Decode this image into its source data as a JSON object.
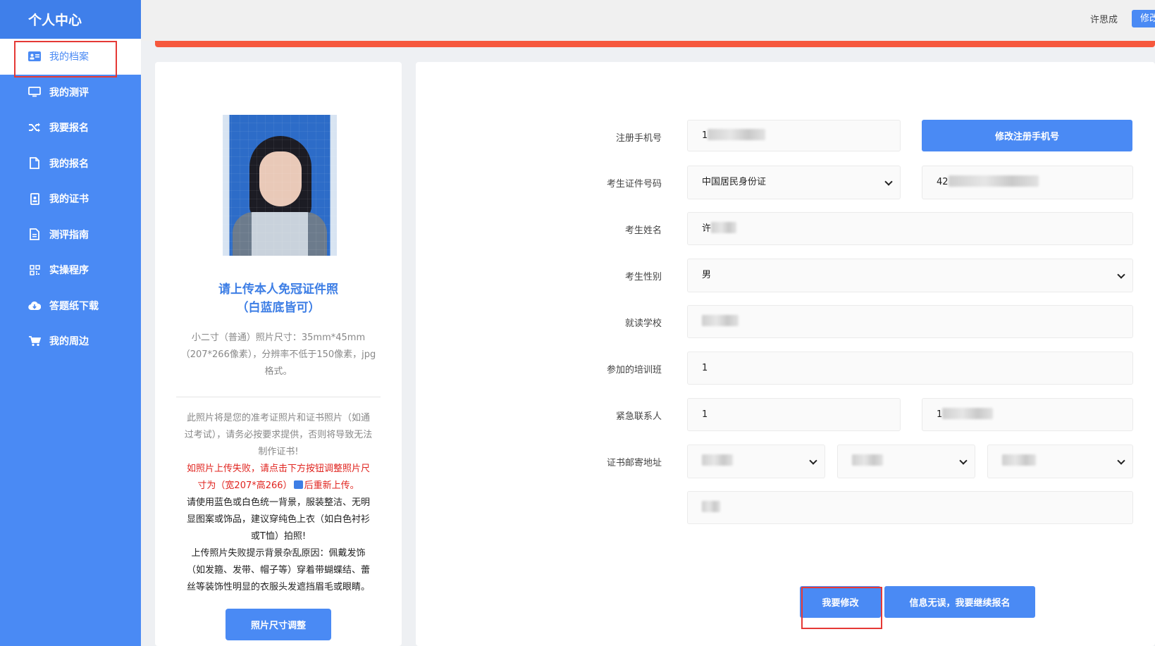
{
  "sidebar": {
    "title": "个人中心",
    "items": [
      {
        "label": "我的档案",
        "icon": "id-card-icon",
        "active": true
      },
      {
        "label": "我的测评",
        "icon": "monitor-icon"
      },
      {
        "label": "我要报名",
        "icon": "shuffle-icon"
      },
      {
        "label": "我的报名",
        "icon": "document-icon"
      },
      {
        "label": "我的证书",
        "icon": "certificate-icon"
      },
      {
        "label": "测评指南",
        "icon": "guide-icon"
      },
      {
        "label": "实操程序",
        "icon": "qrcode-icon"
      },
      {
        "label": "答题纸下载",
        "icon": "cloud-download-icon"
      },
      {
        "label": "我的周边",
        "icon": "cart-icon"
      }
    ]
  },
  "header": {
    "user_name": "许思成",
    "edit_label": "修改"
  },
  "photo_card": {
    "title_line1": "请上传本人免冠证件照",
    "title_line2": "（白蓝底皆可）",
    "spec_line1": "小二寸（普通）照片尺寸：35mm*45mm",
    "spec_line2": "（207*266像素），分辨率不低于150像素，jpg",
    "spec_line3": "格式。",
    "note_gray_1": "此照片将是您的准考证照片和证书照片（如通",
    "note_gray_2": "过考试），请务必按要求提供，否则将导致无法",
    "note_gray_3": "制作证书!",
    "note_red_1": "如照片上传失败，请点击下方按钮调整照片尺",
    "note_red_2a": "寸为（宽207*高266）",
    "note_red_2b": "后重新上传。",
    "note_dark_1": "请使用蓝色或白色统一背景，服装整洁、无明",
    "note_dark_2": "显图案或饰品，建议穿纯色上衣（如白色衬衫",
    "note_dark_3": "或T恤）拍照!",
    "note_dark_4": "上传照片失败提示背景杂乱原因：佩戴发饰",
    "note_dark_5": "（如发箍、发带、帽子等）穿着带蝴蝶结、蕾",
    "note_dark_6": "丝等装饰性明显的衣服头发遮挡眉毛或眼睛。",
    "resize_button": "照片尺寸调整"
  },
  "form": {
    "phone_label": "注册手机号",
    "phone_value": "1",
    "change_phone_button": "修改注册手机号",
    "id_label": "考生证件号码",
    "id_type": "中国居民身份证",
    "id_value": "42",
    "name_label": "考生姓名",
    "name_value": "许",
    "gender_label": "考生性别",
    "gender_value": "男",
    "school_label": "就读学校",
    "school_value": "",
    "training_label": "参加的培训班",
    "training_value": "1",
    "emergency_label": "紧急联系人",
    "emergency_name": "1",
    "emergency_phone": "1",
    "address_label": "证书邮寄地址"
  },
  "actions": {
    "edit_button": "我要修改",
    "continue_button": "信息无误，我要继续报名"
  }
}
